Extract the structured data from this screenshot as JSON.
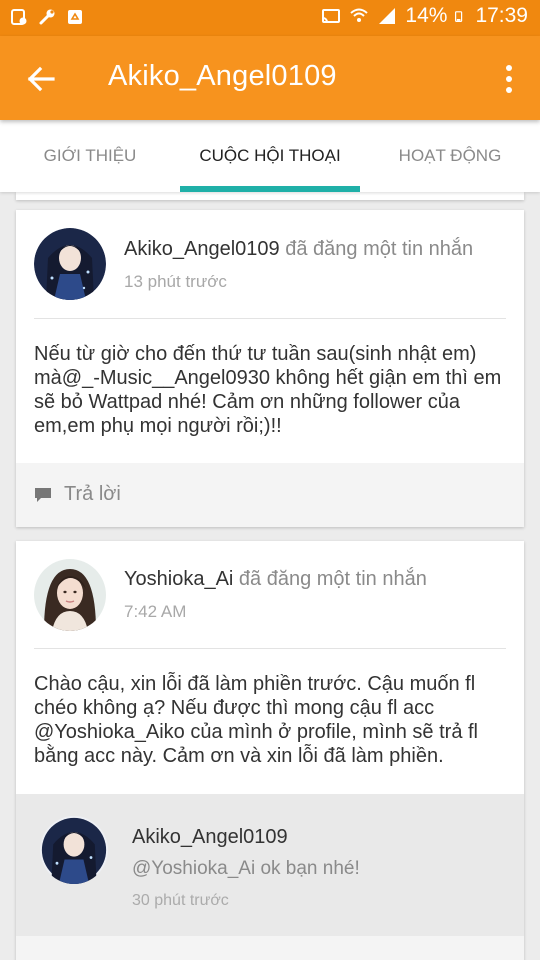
{
  "status_bar": {
    "battery_percent": "14%",
    "time": "17:39"
  },
  "app_bar": {
    "title": "Akiko_Angel0109"
  },
  "tabs": [
    {
      "label": "GIỚI THIỆU"
    },
    {
      "label": "CUỘC HỘI THOẠI"
    },
    {
      "label": "HOẠT ĐỘNG"
    }
  ],
  "posts": [
    {
      "username": "Akiko_Angel0109",
      "action": "đã đăng một tin nhắn",
      "time": "13 phút trước",
      "message": "Nếu từ giờ cho đến thứ tư tuần sau(sinh nhật em) mà@_-Music__Angel0930 không hết giận em thì em sẽ bỏ Wattpad nhé! Cảm ơn những follower của em,em phụ mọi người rồi;)!!",
      "reply_label": "Trả lời"
    },
    {
      "username": "Yoshioka_Ai",
      "action": "đã đăng một tin nhắn",
      "time": "7:42 AM",
      "message": "Chào cậu, xin lỗi đã làm phiền trước. Cậu muốn fl chéo không ạ? Nếu được thì mong cậu fl acc @Yoshioka_Aiko của mình ở profile, mình sẽ trả fl bằng acc này. Cảm ơn và xin lỗi đã làm phiền.",
      "reply": {
        "username": "Akiko_Angel0109",
        "text": "@Yoshioka_Ai ok bạn nhé!",
        "time": "30 phút trước"
      }
    }
  ],
  "colors": {
    "status_bar": "#f0880f",
    "app_bar": "#f7931e",
    "tab_indicator": "#1fb0a8"
  }
}
